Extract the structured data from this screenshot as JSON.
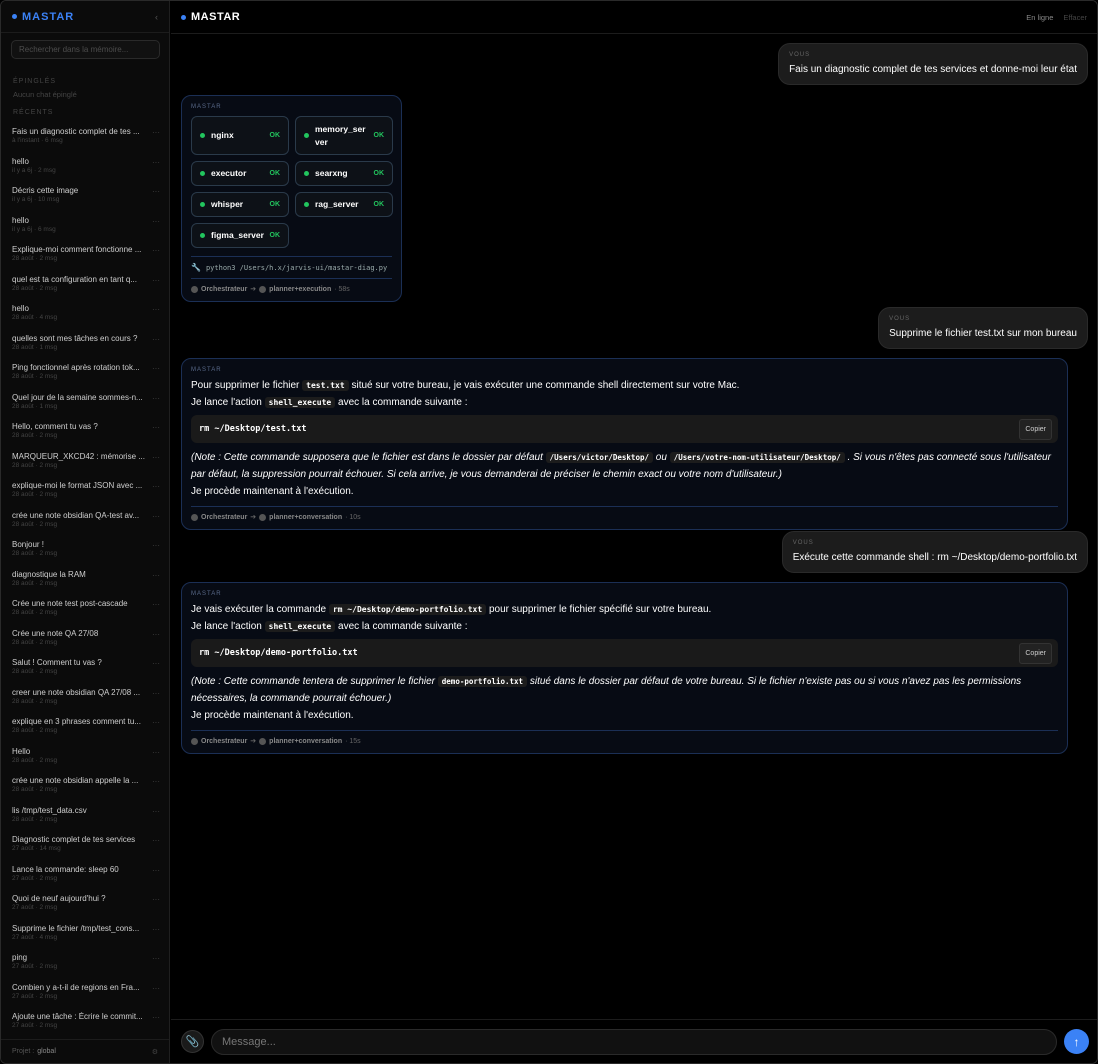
{
  "sidebar": {
    "brand": "MASTAR",
    "collapse_icon": "‹",
    "search_placeholder": "Rechercher dans la mémoire...",
    "pinned_label": "ÉPINGLÉS",
    "pinned_empty": "Aucun chat épinglé",
    "recents_label": "RÉCENTS",
    "recents": [
      {
        "title": "Fais un diagnostic complet de tes ...",
        "meta": "à l'instant · 6 msg"
      },
      {
        "title": "hello",
        "meta": "il y a 6j · 2 msg"
      },
      {
        "title": "Décris cette image",
        "meta": "il y a 6j · 10 msg"
      },
      {
        "title": "hello",
        "meta": "il y a 6j · 6 msg"
      },
      {
        "title": "Explique-moi comment fonctionne ...",
        "meta": "28 août · 2 msg"
      },
      {
        "title": "quel est ta configuration en tant q...",
        "meta": "28 août · 2 msg"
      },
      {
        "title": "hello",
        "meta": "28 août · 4 msg"
      },
      {
        "title": "quelles sont mes tâches en cours ?",
        "meta": "28 août · 1 msg"
      },
      {
        "title": "Ping fonctionnel après rotation tok...",
        "meta": "28 août · 2 msg"
      },
      {
        "title": "Quel jour de la semaine sommes-n...",
        "meta": "28 août · 1 msg"
      },
      {
        "title": "Hello, comment tu vas ?",
        "meta": "28 août · 2 msg"
      },
      {
        "title": "MARQUEUR_XKCD42 : mémorise ...",
        "meta": "28 août · 2 msg"
      },
      {
        "title": "explique-moi le format JSON avec ...",
        "meta": "28 août · 2 msg"
      },
      {
        "title": "crée une note obsidian QA-test av...",
        "meta": "28 août · 2 msg"
      },
      {
        "title": "Bonjour !",
        "meta": "28 août · 2 msg"
      },
      {
        "title": "diagnostique la RAM",
        "meta": "28 août · 2 msg"
      },
      {
        "title": "Crée une note test post-cascade",
        "meta": "28 août · 2 msg"
      },
      {
        "title": "Crée une note QA 27/08",
        "meta": "28 août · 2 msg"
      },
      {
        "title": "Salut ! Comment tu vas ?",
        "meta": "28 août · 2 msg"
      },
      {
        "title": "creer une note obsidian QA 27/08 ...",
        "meta": "28 août · 2 msg"
      },
      {
        "title": "explique en 3 phrases comment tu...",
        "meta": "28 août · 2 msg"
      },
      {
        "title": "Hello",
        "meta": "28 août · 2 msg"
      },
      {
        "title": "crée une note obsidian appelle la ...",
        "meta": "28 août · 2 msg"
      },
      {
        "title": "lis /tmp/test_data.csv",
        "meta": "28 août · 2 msg"
      },
      {
        "title": "Diagnostic complet de tes services",
        "meta": "27 août · 14 msg"
      },
      {
        "title": "Lance la commande: sleep 60",
        "meta": "27 août · 2 msg"
      },
      {
        "title": "Quoi de neuf aujourd'hui ?",
        "meta": "27 août · 2 msg"
      },
      {
        "title": "Supprime le fichier /tmp/test_cons...",
        "meta": "27 août · 4 msg"
      },
      {
        "title": "ping",
        "meta": "27 août · 2 msg"
      },
      {
        "title": "Combien y a-t-il de regions en Fra...",
        "meta": "27 août · 2 msg"
      },
      {
        "title": "Ajoute une tâche : Écrire le commit...",
        "meta": "27 août · 2 msg"
      }
    ],
    "footer_label": "Projet :",
    "footer_project": "global",
    "footer_icon": "⚙"
  },
  "header": {
    "title": "MASTAR",
    "status": "En ligne",
    "clear": "Effacer"
  },
  "messages": {
    "u1": {
      "label": "VOUS",
      "text": "Fais un diagnostic complet de tes services et donne-moi leur état"
    },
    "b1": {
      "label": "MASTAR",
      "services": [
        {
          "name": "nginx",
          "status": "OK"
        },
        {
          "name": "memory_server",
          "status": "OK"
        },
        {
          "name": "executor",
          "status": "OK"
        },
        {
          "name": "searxng",
          "status": "OK"
        },
        {
          "name": "whisper",
          "status": "OK"
        },
        {
          "name": "rag_server",
          "status": "OK"
        },
        {
          "name": "figma_server",
          "status": "OK"
        }
      ],
      "command": "python3 /Users/h.x/jarvis-ui/mastar-diag.py",
      "route_from": "Orchestrateur",
      "route_to": "planner+execution",
      "duration": "· 58s"
    },
    "u2": {
      "label": "VOUS",
      "text": "Supprime le fichier test.txt sur mon bureau"
    },
    "b2": {
      "label": "MASTAR",
      "l1a": "Pour supprimer le fichier",
      "l1code": "test.txt",
      "l1b": "situé sur votre bureau, je vais exécuter une commande shell directement sur votre Mac.",
      "l2a": "Je lance l'action",
      "l2code": "shell_execute",
      "l2b": "avec la commande suivante :",
      "codeblock": "rm ~/Desktop/test.txt",
      "copy": "Copier",
      "note_a": "(Note : Cette commande supposera que le fichier est dans le dossier par défaut",
      "note_code1": "/Users/victor/Desktop/",
      "note_b": "ou",
      "note_code2": "/Users/votre-nom-utilisateur/Desktop/",
      "note_c": ". Si vous n'êtes pas connecté sous l'utilisateur par défaut, la suppression pourrait échouer. Si cela arrive, je vous demanderai de préciser le chemin exact ou votre nom d'utilisateur.)",
      "final": "Je procède maintenant à l'exécution.",
      "route_from": "Orchestrateur",
      "route_to": "planner+conversation",
      "duration": "· 10s"
    },
    "u3": {
      "label": "VOUS",
      "text": "Exécute cette commande shell : rm ~/Desktop/demo-portfolio.txt"
    },
    "b3": {
      "label": "MASTAR",
      "l1a": "Je vais exécuter la commande",
      "l1code": "rm ~/Desktop/demo-portfolio.txt",
      "l1b": "pour supprimer le fichier spécifié sur votre bureau.",
      "l2a": "Je lance l'action",
      "l2code": "shell_execute",
      "l2b": "avec la commande suivante :",
      "codeblock": "rm ~/Desktop/demo-portfolio.txt",
      "copy": "Copier",
      "note_a": "(Note : Cette commande tentera de supprimer le fichier",
      "note_code1": "demo-portfolio.txt",
      "note_b": "situé dans le dossier par défaut de votre bureau. Si le fichier n'existe pas ou si vous n'avez pas les permissions nécessaires, la commande pourrait échouer.)",
      "final": "Je procède maintenant à l'exécution.",
      "route_from": "Orchestrateur",
      "route_to": "planner+conversation",
      "duration": "· 15s"
    }
  },
  "composer": {
    "placeholder": "Message...",
    "attach_icon": "📎",
    "send_icon": "↑"
  },
  "colors": {
    "accent": "#3b82f6",
    "ok": "#22c55e",
    "bot_border": "#1b2f55"
  }
}
